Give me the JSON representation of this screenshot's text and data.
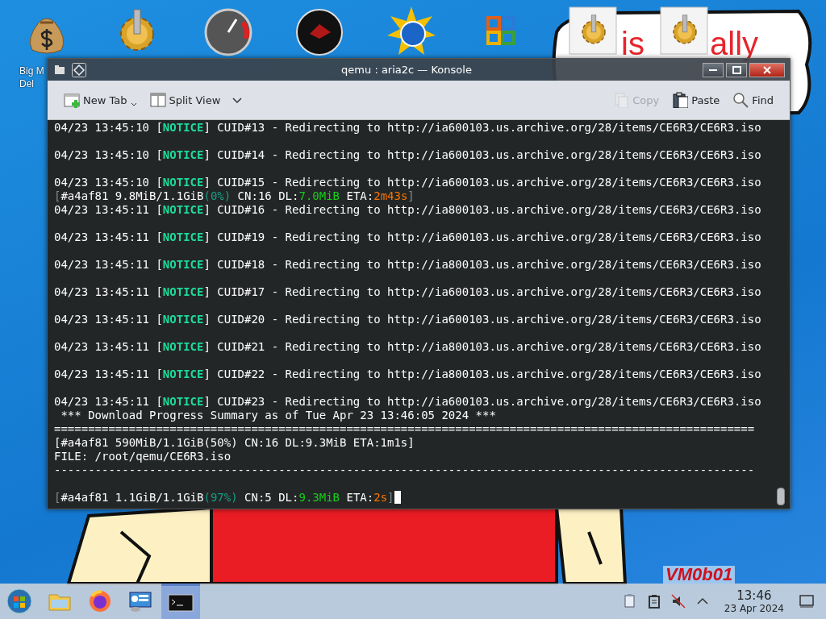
{
  "desktop": {
    "icons": [
      {
        "kind": "money",
        "label": [
          "Big M",
          "Del"
        ]
      },
      {
        "kind": "gear"
      },
      {
        "kind": "gauge"
      },
      {
        "kind": "disc"
      },
      {
        "kind": "sun"
      },
      {
        "kind": "office"
      },
      {
        "kind": "tile"
      },
      {
        "kind": "tile"
      }
    ],
    "wallpaper_texts": [
      {
        "kind": "board",
        "text": "is"
      },
      {
        "kind": "board",
        "text": "ally"
      },
      {
        "kind": "sign",
        "text": "VM0b01"
      }
    ]
  },
  "window": {
    "title": "qemu : aria2c — Konsole",
    "toolbar_left": [
      {
        "label": "New Tab"
      },
      {
        "label": "Split View"
      }
    ],
    "toolbar_right": [
      {
        "label": "Copy",
        "disabled": true
      },
      {
        "label": "Paste",
        "disabled": false
      },
      {
        "label": "Find",
        "disabled": false
      }
    ],
    "terminal": {
      "lines": [
        {
          "kind": "text",
          "segments": [
            {
              "kind": "plain",
              "text": "04/23 13:45:10 ["
            },
            {
              "kind": "notice",
              "text": "NOTICE"
            },
            {
              "kind": "plain",
              "text": "] CUID#13 - Redirecting to http://ia600103.us.archive.org/28/items/CE6R3/CE6R3.iso"
            }
          ]
        },
        {
          "kind": "blank"
        },
        {
          "kind": "text",
          "segments": [
            {
              "kind": "plain",
              "text": "04/23 13:45:10 ["
            },
            {
              "kind": "notice",
              "text": "NOTICE"
            },
            {
              "kind": "plain",
              "text": "] CUID#14 - Redirecting to http://ia600103.us.archive.org/28/items/CE6R3/CE6R3.iso"
            }
          ]
        },
        {
          "kind": "blank"
        },
        {
          "kind": "text",
          "segments": [
            {
              "kind": "plain",
              "text": "04/23 13:45:10 ["
            },
            {
              "kind": "notice",
              "text": "NOTICE"
            },
            {
              "kind": "plain",
              "text": "] CUID#15 - Redirecting to http://ia600103.us.archive.org/28/items/CE6R3/CE6R3.iso"
            }
          ]
        },
        {
          "kind": "text",
          "segments": [
            {
              "kind": "dim",
              "text": "["
            },
            {
              "kind": "plain",
              "text": "#a4af81 9.8MiB/1.1GiB"
            },
            {
              "kind": "percent",
              "text": "(0%)"
            },
            {
              "kind": "plain",
              "text": " CN:16 DL:"
            },
            {
              "kind": "green",
              "text": "7.0MiB"
            },
            {
              "kind": "plain",
              "text": " ETA:"
            },
            {
              "kind": "orange",
              "text": "2m43s"
            },
            {
              "kind": "dim",
              "text": "]"
            }
          ]
        },
        {
          "kind": "text",
          "segments": [
            {
              "kind": "plain",
              "text": "04/23 13:45:11 ["
            },
            {
              "kind": "notice",
              "text": "NOTICE"
            },
            {
              "kind": "plain",
              "text": "] CUID#16 - Redirecting to http://ia800103.us.archive.org/28/items/CE6R3/CE6R3.iso"
            }
          ]
        },
        {
          "kind": "blank"
        },
        {
          "kind": "text",
          "segments": [
            {
              "kind": "plain",
              "text": "04/23 13:45:11 ["
            },
            {
              "kind": "notice",
              "text": "NOTICE"
            },
            {
              "kind": "plain",
              "text": "] CUID#19 - Redirecting to http://ia600103.us.archive.org/28/items/CE6R3/CE6R3.iso"
            }
          ]
        },
        {
          "kind": "blank"
        },
        {
          "kind": "text",
          "segments": [
            {
              "kind": "plain",
              "text": "04/23 13:45:11 ["
            },
            {
              "kind": "notice",
              "text": "NOTICE"
            },
            {
              "kind": "plain",
              "text": "] CUID#18 - Redirecting to http://ia800103.us.archive.org/28/items/CE6R3/CE6R3.iso"
            }
          ]
        },
        {
          "kind": "blank"
        },
        {
          "kind": "text",
          "segments": [
            {
              "kind": "plain",
              "text": "04/23 13:45:11 ["
            },
            {
              "kind": "notice",
              "text": "NOTICE"
            },
            {
              "kind": "plain",
              "text": "] CUID#17 - Redirecting to http://ia600103.us.archive.org/28/items/CE6R3/CE6R3.iso"
            }
          ]
        },
        {
          "kind": "blank"
        },
        {
          "kind": "text",
          "segments": [
            {
              "kind": "plain",
              "text": "04/23 13:45:11 ["
            },
            {
              "kind": "notice",
              "text": "NOTICE"
            },
            {
              "kind": "plain",
              "text": "] CUID#20 - Redirecting to http://ia600103.us.archive.org/28/items/CE6R3/CE6R3.iso"
            }
          ]
        },
        {
          "kind": "blank"
        },
        {
          "kind": "text",
          "segments": [
            {
              "kind": "plain",
              "text": "04/23 13:45:11 ["
            },
            {
              "kind": "notice",
              "text": "NOTICE"
            },
            {
              "kind": "plain",
              "text": "] CUID#21 - Redirecting to http://ia800103.us.archive.org/28/items/CE6R3/CE6R3.iso"
            }
          ]
        },
        {
          "kind": "blank"
        },
        {
          "kind": "text",
          "segments": [
            {
              "kind": "plain",
              "text": "04/23 13:45:11 ["
            },
            {
              "kind": "notice",
              "text": "NOTICE"
            },
            {
              "kind": "plain",
              "text": "] CUID#22 - Redirecting to http://ia800103.us.archive.org/28/items/CE6R3/CE6R3.iso"
            }
          ]
        },
        {
          "kind": "blank"
        },
        {
          "kind": "text",
          "segments": [
            {
              "kind": "plain",
              "text": "04/23 13:45:11 ["
            },
            {
              "kind": "notice",
              "text": "NOTICE"
            },
            {
              "kind": "plain",
              "text": "] CUID#23 - Redirecting to http://ia600103.us.archive.org/28/items/CE6R3/CE6R3.iso"
            }
          ]
        },
        {
          "kind": "text",
          "segments": [
            {
              "kind": "plain",
              "text": " *** Download Progress Summary as of Tue Apr 23 13:46:05 2024 ***"
            }
          ]
        },
        {
          "kind": "text",
          "segments": [
            {
              "kind": "plain",
              "text": "======================================================================================================="
            }
          ]
        },
        {
          "kind": "text",
          "segments": [
            {
              "kind": "plain",
              "text": "[#a4af81 590MiB/1.1GiB(50%) CN:16 DL:9.3MiB ETA:1m1s]"
            }
          ]
        },
        {
          "kind": "text",
          "segments": [
            {
              "kind": "plain",
              "text": "FILE: /root/qemu/CE6R3.iso"
            }
          ]
        },
        {
          "kind": "text",
          "segments": [
            {
              "kind": "plain",
              "text": "-------------------------------------------------------------------------------------------------------"
            }
          ]
        },
        {
          "kind": "blank"
        },
        {
          "kind": "text",
          "cursor": true,
          "segments": [
            {
              "kind": "dim",
              "text": "["
            },
            {
              "kind": "plain",
              "text": "#a4af81 1.1GiB/1.1GiB"
            },
            {
              "kind": "percent",
              "text": "(97%)"
            },
            {
              "kind": "plain",
              "text": " CN:5 DL:"
            },
            {
              "kind": "green",
              "text": "9.3MiB"
            },
            {
              "kind": "plain",
              "text": " ETA:"
            },
            {
              "kind": "orange",
              "text": "2s"
            },
            {
              "kind": "dim",
              "text": "]"
            }
          ]
        }
      ]
    }
  },
  "taskbar": {
    "apps": [
      {
        "selected": false
      },
      {
        "selected": false
      },
      {
        "selected": false
      },
      {
        "selected": false
      },
      {
        "selected": true
      }
    ],
    "clock": {
      "time": "13:46",
      "date": "23 Apr 2024"
    }
  }
}
